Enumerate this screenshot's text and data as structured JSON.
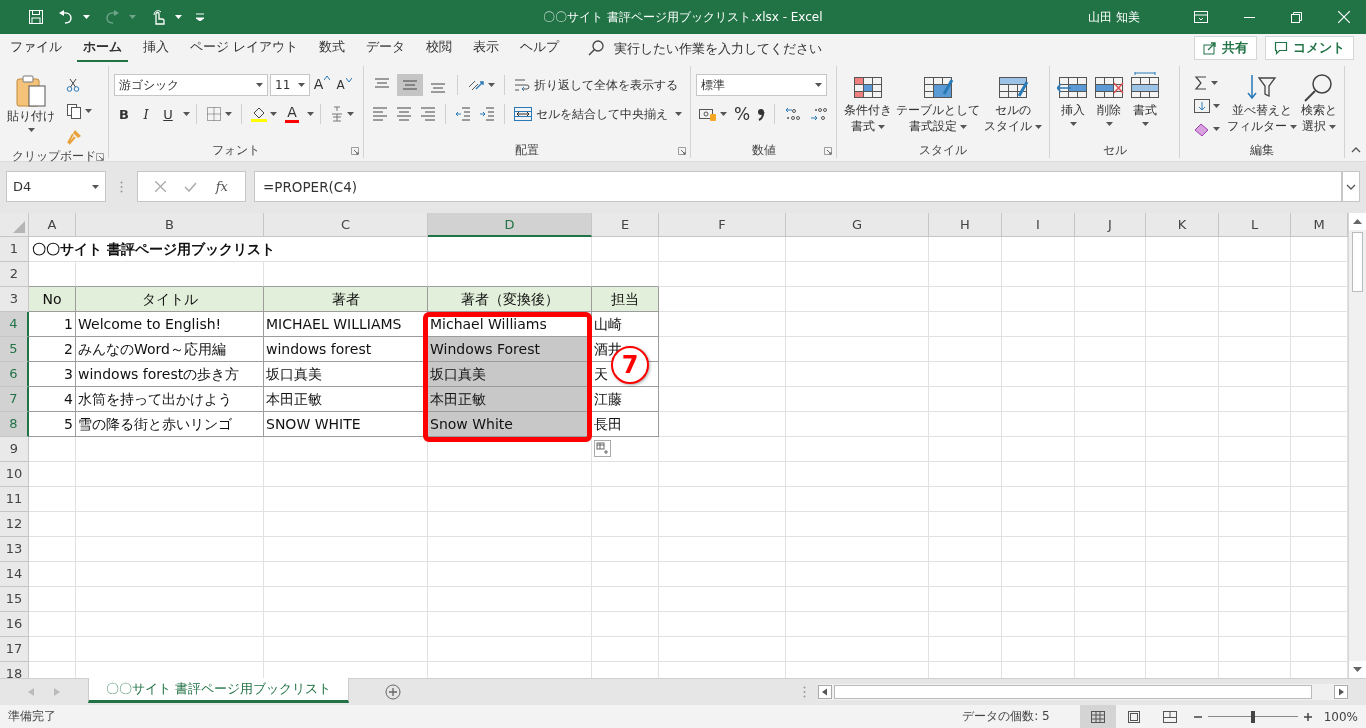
{
  "title_bar": {
    "title": "〇〇サイト 書評ページ用ブックリスト.xlsx  -  Excel",
    "user": "山田 知美"
  },
  "menu": {
    "tabs": [
      {
        "label": "ファイル",
        "selected": false
      },
      {
        "label": "ホーム",
        "selected": true
      },
      {
        "label": "挿入",
        "selected": false
      },
      {
        "label": "ページ レイアウト",
        "selected": false
      },
      {
        "label": "数式",
        "selected": false
      },
      {
        "label": "データ",
        "selected": false
      },
      {
        "label": "校閲",
        "selected": false
      },
      {
        "label": "表示",
        "selected": false
      },
      {
        "label": "ヘルプ",
        "selected": false
      }
    ],
    "tell_me": {
      "placeholder": "実行したい作業を入力してください"
    },
    "share": "共有",
    "comment": "コメント"
  },
  "ribbon": {
    "clipboard": {
      "paste": "貼り付け",
      "label": "クリップボード"
    },
    "font": {
      "font_name": "游ゴシック",
      "font_size": "11",
      "grow": "A",
      "shrink": "A",
      "bold": "B",
      "italic": "I",
      "underline": "U",
      "font_color": "A",
      "label": "フォント"
    },
    "alignment": {
      "vertical": [
        {
          "selected": false
        },
        {
          "selected": true
        },
        {
          "selected": false
        }
      ],
      "wrap_text": "折り返して全体を表示する",
      "merge_center": "セルを結合して中央揃え",
      "label": "配置"
    },
    "number": {
      "format": "標準",
      "percent": "%",
      "label": "数値"
    },
    "styles": {
      "buttons": [
        {
          "kind": "conditional",
          "lines": [
            "条件付き",
            "書式"
          ]
        },
        {
          "kind": "table",
          "lines": [
            "テーブルとして",
            "書式設定"
          ]
        },
        {
          "kind": "cellstyle",
          "lines": [
            "セルの",
            "スタイル"
          ]
        }
      ],
      "label": "スタイル"
    },
    "cells": {
      "buttons": [
        {
          "kind": "insert",
          "lines": [
            "挿入"
          ]
        },
        {
          "kind": "delete",
          "lines": [
            "削除"
          ]
        },
        {
          "kind": "format",
          "lines": [
            "書式"
          ]
        }
      ],
      "label": "セル"
    },
    "editing": {
      "buttons": [
        {
          "kind": "sort",
          "lines": [
            "並べ替えと",
            "フィルター"
          ]
        },
        {
          "kind": "find",
          "lines": [
            "検索と",
            "選択"
          ]
        }
      ],
      "label": "編集"
    }
  },
  "formula_bar": {
    "name_box": "D4",
    "fx": "fx",
    "formula": "=PROPER(C4)"
  },
  "grid": {
    "columns": [
      {
        "label": "A",
        "selected": false
      },
      {
        "label": "B",
        "selected": false
      },
      {
        "label": "C",
        "selected": false
      },
      {
        "label": "D",
        "selected": true
      },
      {
        "label": "E",
        "selected": false
      },
      {
        "label": "F",
        "selected": false
      },
      {
        "label": "G",
        "selected": false
      },
      {
        "label": "H",
        "selected": false
      },
      {
        "label": "I",
        "selected": false
      },
      {
        "label": "J",
        "selected": false
      },
      {
        "label": "K",
        "selected": false
      },
      {
        "label": "L",
        "selected": false
      },
      {
        "label": "M",
        "selected": false
      }
    ],
    "rows": [
      {
        "number": "1",
        "kind": "title",
        "selected": false,
        "cells": {
          "A": {
            "text": "〇〇サイト 書評ページ用ブックリスト",
            "selected": false
          }
        }
      },
      {
        "number": "2",
        "kind": "blank",
        "selected": false,
        "cells": {}
      },
      {
        "number": "3",
        "kind": "header",
        "selected": false,
        "cells": {
          "A": {
            "text": "No",
            "selected": false
          },
          "B": {
            "text": "タイトル",
            "selected": false
          },
          "C": {
            "text": "著者",
            "selected": false
          },
          "D": {
            "text": "著者（変換後）",
            "selected": false
          },
          "E": {
            "text": "担当",
            "selected": false
          }
        }
      },
      {
        "number": "4",
        "kind": "data",
        "selected": true,
        "cells": {
          "A": {
            "text": "1",
            "selected": false
          },
          "B": {
            "text": "Welcome to English!",
            "selected": false
          },
          "C": {
            "text": "MICHAEL WILLIAMS",
            "selected": false
          },
          "D": {
            "text": "Michael Williams",
            "selected": false
          },
          "E": {
            "text": "山崎",
            "selected": false
          }
        }
      },
      {
        "number": "5",
        "kind": "data",
        "selected": true,
        "cells": {
          "A": {
            "text": "2",
            "selected": false
          },
          "B": {
            "text": "みんなのWord～応用編",
            "selected": false
          },
          "C": {
            "text": "windows forest",
            "selected": false
          },
          "D": {
            "text": "Windows Forest",
            "selected": true
          },
          "E": {
            "text": "酒井",
            "selected": false
          }
        }
      },
      {
        "number": "6",
        "kind": "data",
        "selected": true,
        "cells": {
          "A": {
            "text": "3",
            "selected": false
          },
          "B": {
            "text": "windows forestの歩き方",
            "selected": false
          },
          "C": {
            "text": "坂口真美",
            "selected": false
          },
          "D": {
            "text": "坂口真美",
            "selected": true
          },
          "E": {
            "text": "天",
            "selected": false
          }
        }
      },
      {
        "number": "7",
        "kind": "data",
        "selected": true,
        "cells": {
          "A": {
            "text": "4",
            "selected": false
          },
          "B": {
            "text": "水筒を持って出かけよう",
            "selected": false
          },
          "C": {
            "text": "本田正敏",
            "selected": false
          },
          "D": {
            "text": "本田正敏",
            "selected": true
          },
          "E": {
            "text": "江藤",
            "selected": false
          }
        }
      },
      {
        "number": "8",
        "kind": "data",
        "selected": true,
        "cells": {
          "A": {
            "text": "5",
            "selected": false
          },
          "B": {
            "text": "雪の降る街と赤いリンゴ",
            "selected": false
          },
          "C": {
            "text": "SNOW WHITE",
            "selected": false
          },
          "D": {
            "text": "Snow White",
            "selected": true
          },
          "E": {
            "text": "長田",
            "selected": false
          }
        }
      },
      {
        "number": "9",
        "kind": "blank",
        "selected": false,
        "cells": {}
      },
      {
        "number": "10",
        "kind": "blank",
        "selected": false,
        "cells": {}
      },
      {
        "number": "11",
        "kind": "blank",
        "selected": false,
        "cells": {}
      },
      {
        "number": "12",
        "kind": "blank",
        "selected": false,
        "cells": {}
      },
      {
        "number": "13",
        "kind": "blank",
        "selected": false,
        "cells": {}
      },
      {
        "number": "14",
        "kind": "blank",
        "selected": false,
        "cells": {}
      },
      {
        "number": "15",
        "kind": "blank",
        "selected": false,
        "cells": {}
      },
      {
        "number": "16",
        "kind": "blank",
        "selected": false,
        "cells": {}
      },
      {
        "number": "17",
        "kind": "blank",
        "selected": false,
        "cells": {}
      },
      {
        "number": "18",
        "kind": "blank",
        "selected": false,
        "cells": {}
      }
    ]
  },
  "annotation": {
    "number": "7"
  },
  "sheet_tabs": [
    {
      "label": "〇〇サイト 書評ページ用ブックリスト",
      "selected": true
    }
  ],
  "status_bar": {
    "status": "準備完了",
    "summary": "データの個数: 5",
    "views": [
      {
        "kind": "normal",
        "selected": true
      },
      {
        "kind": "page_layout",
        "selected": false
      },
      {
        "kind": "page_break",
        "selected": false
      }
    ],
    "zoom": {
      "level": 0.5,
      "text": "100%"
    }
  }
}
